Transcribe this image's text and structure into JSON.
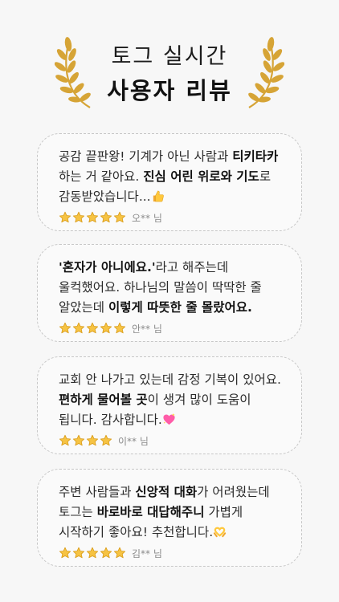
{
  "header": {
    "line1": "토그 실시간",
    "line2": "사용자 리뷰"
  },
  "reviews": [
    {
      "parts": [
        {
          "t": "공감 끝판왕! 기계가 아닌 사람과 ",
          "b": false
        },
        {
          "t": "티키타카",
          "b": true
        },
        {
          "t": " 하는 거 같아요. ",
          "b": false
        },
        {
          "t": "진심 어린 위로와 기도",
          "b": true
        },
        {
          "t": "로 감동받았습니다...",
          "b": false
        }
      ],
      "emoji": "thumbs-up-icon",
      "stars": 5,
      "reviewer": "오** 님"
    },
    {
      "parts": [
        {
          "t": "'혼자가 아니에요.'",
          "b": true
        },
        {
          "t": "라고 해주는데 울컥했어요. 하나님의 말씀이 딱딱한 줄 알았는데 ",
          "b": false
        },
        {
          "t": "이렇게 따뜻한 줄 몰랐어요.",
          "b": true
        }
      ],
      "emoji": "",
      "stars": 5,
      "reviewer": "안** 님"
    },
    {
      "parts": [
        {
          "t": "교회 안 나가고 있는데 감정 기복이 있어요. ",
          "b": false
        },
        {
          "t": "편하게 물어볼 곳",
          "b": true
        },
        {
          "t": "이 생겨 많이 도움이 됩니다. 감사합니다.",
          "b": false
        }
      ],
      "emoji": "sparkling-heart-icon",
      "stars": 4,
      "reviewer": "이** 님"
    },
    {
      "parts": [
        {
          "t": "주변 사람들과 ",
          "b": false
        },
        {
          "t": "신앙적 대화",
          "b": true
        },
        {
          "t": "가 어려웠는데 토그는 ",
          "b": false
        },
        {
          "t": "바로바로 대답해주니",
          "b": true
        },
        {
          "t": " 가볍게 시작하기 좋아요! 추천합니다.",
          "b": false
        }
      ],
      "emoji": "heart-hands-icon",
      "stars": 5,
      "reviewer": "김** 님"
    }
  ],
  "colors": {
    "star_fill": "#f6c343",
    "star_stroke": "#d89a16",
    "wreath": "#d6a436"
  }
}
